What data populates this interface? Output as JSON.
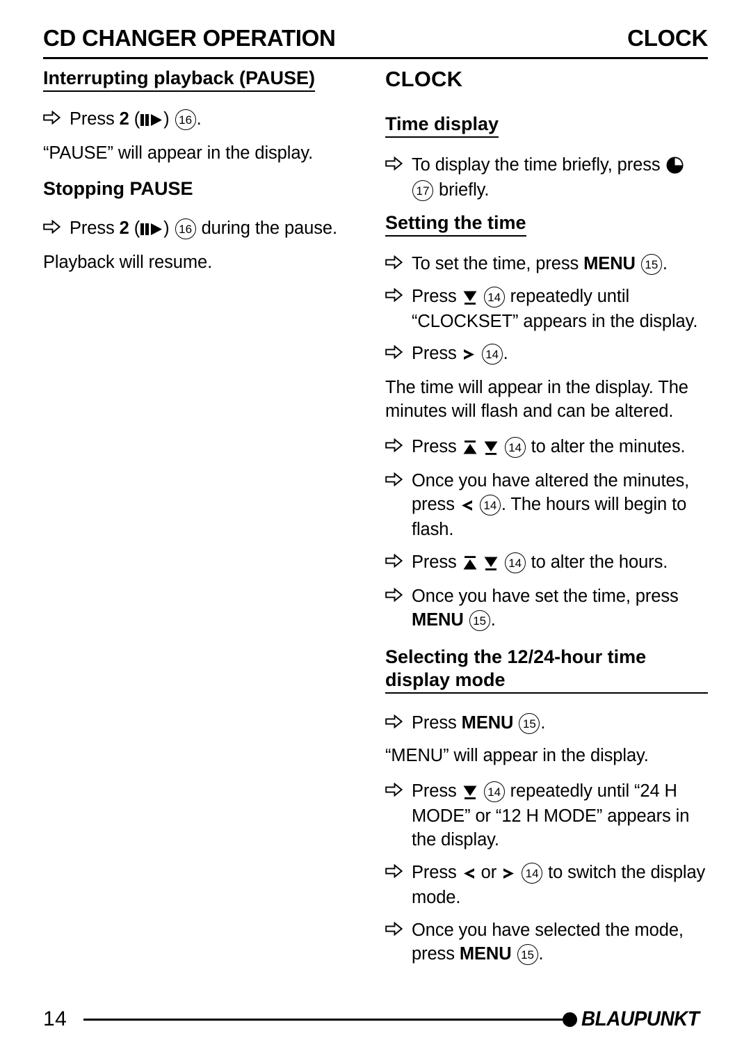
{
  "header": {
    "left_title": "CD CHANGER OPERATION",
    "right_title": "CLOCK"
  },
  "left_column": {
    "heading_1": "Interrupting playback (PAUSE)",
    "step_1_press": "Press ",
    "step_1_num": "2",
    "step_1_paren_open": "(",
    "step_1_paren_close": ")",
    "step_1_ref": "16",
    "step_1_end": ".",
    "para_1": "“PAUSE” will appear in the display.",
    "heading_2": "Stopping PAUSE",
    "step_2_press": "Press ",
    "step_2_num": "2",
    "step_2_paren_open": "(",
    "step_2_paren_close": ")",
    "step_2_ref": "16",
    "step_2_end": " during the pause.",
    "para_2": "Playback will resume."
  },
  "right_column": {
    "section_title": "CLOCK",
    "heading_time_display": "Time display",
    "time_display_step_a": "To display the time briefly, press ",
    "time_display_ref": "17",
    "time_display_step_b": " briefly.",
    "heading_setting_time": "Setting the time",
    "set_step_1_a": "To set the time, press ",
    "set_step_1_menu": "MENU",
    "set_step_1_ref": "15",
    "set_step_1_b": ".",
    "set_step_2_a": "Press ",
    "set_step_2_ref": "14",
    "set_step_2_b": " repeatedly until “CLOCKSET” appears in the display.",
    "set_step_3_a": "Press ",
    "set_step_3_ref": "14",
    "set_step_3_b": ".",
    "para_time_appear": "The time will appear in the display. The minutes will flash and can be altered.",
    "set_step_4_a": "Press ",
    "set_step_4_ref": "14",
    "set_step_4_b": " to alter the minutes.",
    "set_step_5_a": "Once you have altered the minutes, press ",
    "set_step_5_ref": "14",
    "set_step_5_b": ". The hours will begin to flash.",
    "set_step_6_a": "Press ",
    "set_step_6_ref": "14",
    "set_step_6_b": " to alter the hours.",
    "set_step_7_a": "Once you have set the time, press ",
    "set_step_7_menu": "MENU",
    "set_step_7_ref": "15",
    "set_step_7_b": ".",
    "heading_1224": "Selecting the 12/24-hour time display mode",
    "mode_step_1_a": "Press ",
    "mode_step_1_menu": "MENU",
    "mode_step_1_ref": "15",
    "mode_step_1_b": ".",
    "para_menu_appear": "“MENU” will appear in the display.",
    "mode_step_2_a": "Press ",
    "mode_step_2_ref": "14",
    "mode_step_2_b": " repeatedly until “24 H MODE” or “12 H MODE” appears in the display.",
    "mode_step_3_a": "Press ",
    "mode_step_3_or": " or ",
    "mode_step_3_ref": "14",
    "mode_step_3_b": " to switch the display mode.",
    "mode_step_4_a": "Once you have selected the mode, press ",
    "mode_step_4_menu": "MENU",
    "mode_step_4_ref": "15",
    "mode_step_4_b": "."
  },
  "footer": {
    "page_number": "14",
    "brand": "BLAUPUNKT"
  },
  "icons": {
    "bullet": "arrow-right-hollow-icon",
    "playpause": "play-pause-icon",
    "clock": "clock-icon",
    "up": "rocker-up-icon",
    "down": "rocker-down-icon",
    "left": "chevron-left-icon",
    "right": "chevron-right-icon"
  },
  "colors": {
    "ink": "#000000",
    "paper": "#ffffff"
  }
}
